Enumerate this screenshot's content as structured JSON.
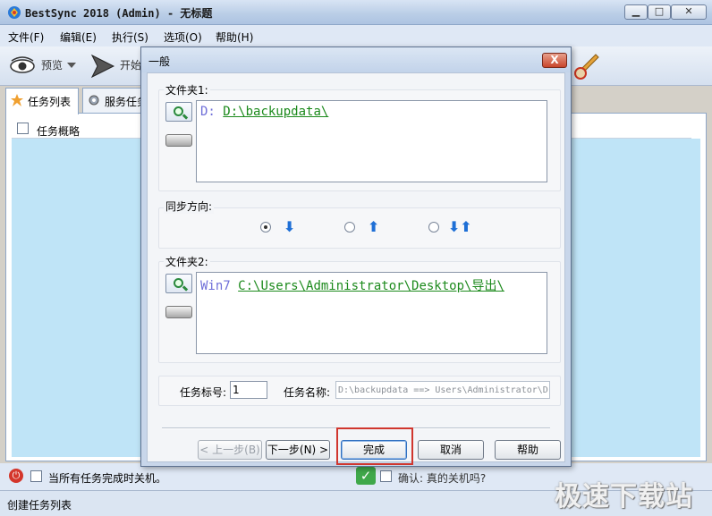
{
  "window": {
    "title": "BestSync 2018 (Admin) - 无标题",
    "min_label": "▁",
    "max_label": "□",
    "close_label": "✕"
  },
  "menu": {
    "items": [
      {
        "label": "文件(F)"
      },
      {
        "label": "编辑(E)"
      },
      {
        "label": "执行(S)"
      },
      {
        "label": "选项(O)"
      },
      {
        "label": "帮助(H)"
      }
    ]
  },
  "toolbar": {
    "preview_label": "预览",
    "start_label": "开始"
  },
  "tabs": [
    {
      "label": "任务列表"
    },
    {
      "label": "服务任务"
    }
  ],
  "task_list": {
    "column_header": "任务概略"
  },
  "bottom": {
    "shutdown_label": "当所有任务完成时关机。",
    "confirm_label": "确认: 真的关机吗?"
  },
  "status": {
    "text": "创建任务列表"
  },
  "watermark": "极速下载站",
  "dialog": {
    "title": "一般",
    "close_label": "X",
    "folder1": {
      "label": "文件夹1:",
      "drive": "D:",
      "path": "D:\\backupdata\\"
    },
    "sync_direction": {
      "label": "同步方向:",
      "selected": "down",
      "options": [
        "down",
        "up",
        "both"
      ]
    },
    "folder2": {
      "label": "文件夹2:",
      "drive": "Win7",
      "path": "C:\\Users\\Administrator\\Desktop\\导出\\"
    },
    "task_number_label": "任务标号:",
    "task_number_value": "1",
    "task_name_label": "任务名称:",
    "task_name_value": "D:\\backupdata ==> Users\\Administrator\\D",
    "buttons": {
      "prev": "< 上一步(B)",
      "next": "下一步(N) >",
      "finish": "完成",
      "cancel": "取消",
      "help": "帮助"
    }
  }
}
